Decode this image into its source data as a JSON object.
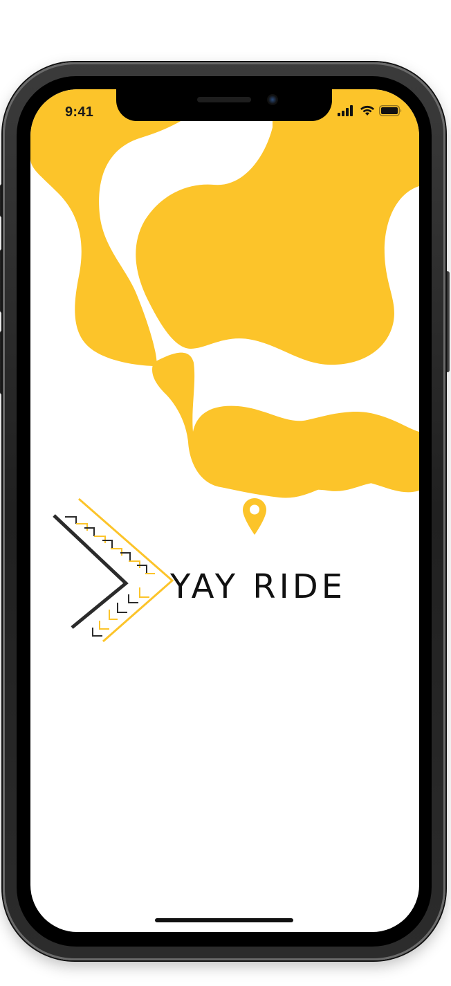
{
  "status_bar": {
    "time": "9:41"
  },
  "brand": {
    "name": "YAY RIDE"
  },
  "icons": {
    "signal": "cellular-signal-icon",
    "wifi": "wifi-icon",
    "battery": "battery-icon",
    "location": "location-pin-icon"
  },
  "colors": {
    "accent_yellow": "#FCC42A",
    "dark": "#2B2B2B",
    "background": "#FFFFFF"
  }
}
